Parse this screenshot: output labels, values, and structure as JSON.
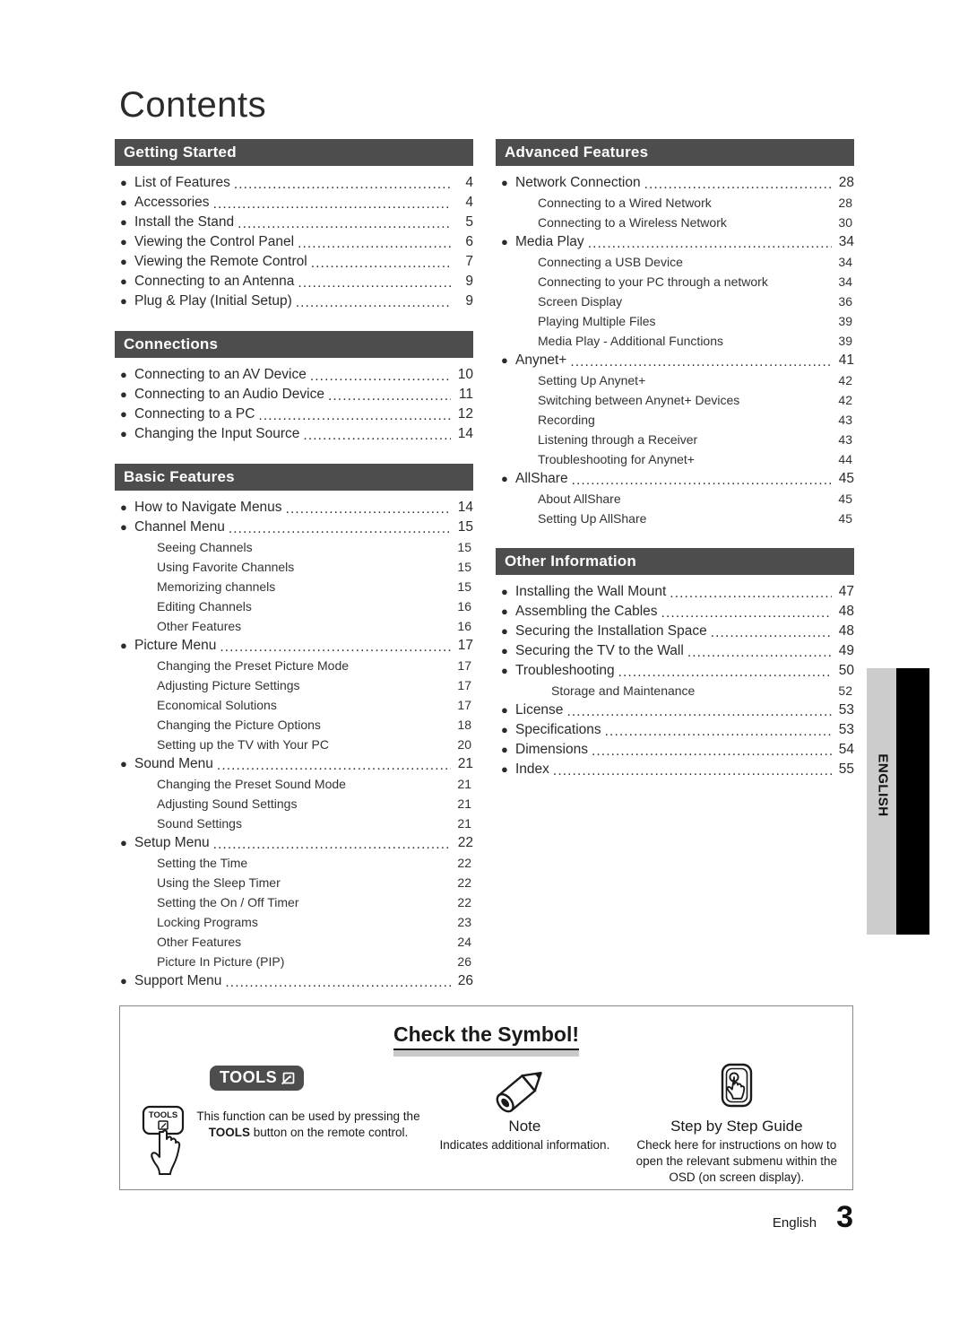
{
  "page": {
    "title": "Contents",
    "footer_language": "English",
    "footer_page_number": "3",
    "side_tab_label": "ENGLISH",
    "accent_bar_color": "#4d4d4d",
    "side_tab_gray": "#cccccc",
    "side_tab_black": "#000000"
  },
  "columns": {
    "left": [
      {
        "heading": "Getting Started",
        "entries": [
          {
            "level": 1,
            "label": "List of Features",
            "page": "4"
          },
          {
            "level": 1,
            "label": "Accessories",
            "page": "4"
          },
          {
            "level": 1,
            "label": "Install the Stand",
            "page": "5"
          },
          {
            "level": 1,
            "label": "Viewing the Control Panel",
            "page": "6"
          },
          {
            "level": 1,
            "label": "Viewing the Remote Control",
            "page": "7"
          },
          {
            "level": 1,
            "label": "Connecting to an Antenna",
            "page": "9"
          },
          {
            "level": 1,
            "label": "Plug & Play (Initial Setup)",
            "page": "9"
          }
        ]
      },
      {
        "heading": "Connections",
        "entries": [
          {
            "level": 1,
            "label": "Connecting to an AV Device",
            "page": "10"
          },
          {
            "level": 1,
            "label": "Connecting to an Audio Device",
            "page": "11"
          },
          {
            "level": 1,
            "label": "Connecting to a PC",
            "page": "12"
          },
          {
            "level": 1,
            "label": "Changing the Input Source",
            "page": "14"
          }
        ]
      },
      {
        "heading": "Basic Features",
        "entries": [
          {
            "level": 1,
            "label": "How to Navigate Menus",
            "page": "14"
          },
          {
            "level": 1,
            "label": "Channel Menu",
            "page": "15"
          },
          {
            "level": 2,
            "label": "Seeing Channels",
            "page": "15"
          },
          {
            "level": 2,
            "label": "Using Favorite Channels",
            "page": "15"
          },
          {
            "level": 2,
            "label": "Memorizing channels",
            "page": "15"
          },
          {
            "level": 2,
            "label": "Editing Channels",
            "page": "16"
          },
          {
            "level": 2,
            "label": "Other Features",
            "page": "16"
          },
          {
            "level": 1,
            "label": "Picture Menu",
            "page": "17"
          },
          {
            "level": 2,
            "label": "Changing the Preset Picture Mode",
            "page": "17"
          },
          {
            "level": 2,
            "label": "Adjusting Picture Settings",
            "page": "17"
          },
          {
            "level": 2,
            "label": "Economical Solutions",
            "page": "17"
          },
          {
            "level": 2,
            "label": "Changing the Picture Options",
            "page": "18"
          },
          {
            "level": 2,
            "label": "Setting up the TV with Your PC",
            "page": "20"
          },
          {
            "level": 1,
            "label": "Sound Menu",
            "page": "21"
          },
          {
            "level": 2,
            "label": "Changing the Preset Sound Mode",
            "page": "21"
          },
          {
            "level": 2,
            "label": "Adjusting Sound Settings",
            "page": "21"
          },
          {
            "level": 2,
            "label": "Sound Settings",
            "page": "21"
          },
          {
            "level": 1,
            "label": "Setup Menu",
            "page": "22"
          },
          {
            "level": 2,
            "label": "Setting the Time",
            "page": "22"
          },
          {
            "level": 2,
            "label": "Using the Sleep Timer",
            "page": "22"
          },
          {
            "level": 2,
            "label": "Setting the On / Off Timer",
            "page": "22"
          },
          {
            "level": 2,
            "label": "Locking Programs",
            "page": "23"
          },
          {
            "level": 2,
            "label": "Other Features",
            "page": "24"
          },
          {
            "level": 2,
            "label": "Picture In Picture (PIP)",
            "page": "26"
          },
          {
            "level": 1,
            "label": "Support Menu",
            "page": "26"
          }
        ]
      }
    ],
    "right": [
      {
        "heading": "Advanced Features",
        "entries": [
          {
            "level": 1,
            "label": "Network Connection",
            "page": "28"
          },
          {
            "level": 2,
            "label": "Connecting to a Wired Network",
            "page": "28"
          },
          {
            "level": 2,
            "label": "Connecting to a Wireless Network",
            "page": "30"
          },
          {
            "level": 1,
            "label": "Media Play",
            "page": "34"
          },
          {
            "level": 2,
            "label": "Connecting a USB Device",
            "page": "34"
          },
          {
            "level": 2,
            "label": "Connecting to your PC through a network",
            "page": "34"
          },
          {
            "level": 2,
            "label": "Screen Display",
            "page": "36"
          },
          {
            "level": 2,
            "label": "Playing Multiple Files",
            "page": "39"
          },
          {
            "level": 2,
            "label": "Media Play - Additional Functions",
            "page": "39"
          },
          {
            "level": 1,
            "label": "Anynet+",
            "page": "41"
          },
          {
            "level": 2,
            "label": "Setting Up Anynet+",
            "page": "42"
          },
          {
            "level": 2,
            "label": "Switching between Anynet+ Devices",
            "page": "42"
          },
          {
            "level": 2,
            "label": "Recording",
            "page": "43"
          },
          {
            "level": 2,
            "label": "Listening through a Receiver",
            "page": "43"
          },
          {
            "level": 2,
            "label": "Troubleshooting for Anynet+",
            "page": "44"
          },
          {
            "level": 1,
            "label": "AllShare",
            "page": "45"
          },
          {
            "level": 2,
            "label": "About AllShare",
            "page": "45"
          },
          {
            "level": 2,
            "label": "Setting Up AllShare",
            "page": "45"
          }
        ]
      },
      {
        "heading": "Other Information",
        "entries": [
          {
            "level": 1,
            "label": "Installing the Wall Mount",
            "page": "47"
          },
          {
            "level": 1,
            "label": "Assembling the Cables",
            "page": "48"
          },
          {
            "level": 1,
            "label": "Securing the Installation Space",
            "page": "48"
          },
          {
            "level": 1,
            "label": "Securing the TV to the Wall",
            "page": "49"
          },
          {
            "level": 1,
            "label": "Troubleshooting",
            "page": "50"
          },
          {
            "level": 3,
            "label": "Storage and Maintenance",
            "page": "52"
          },
          {
            "level": 1,
            "label": "License",
            "page": "53"
          },
          {
            "level": 1,
            "label": "Specifications",
            "page": "53"
          },
          {
            "level": 1,
            "label": "Dimensions",
            "page": "54"
          },
          {
            "level": 1,
            "label": "Index",
            "page": "55"
          }
        ]
      }
    ]
  },
  "symbol_box": {
    "title": "Check the Symbol!",
    "items": [
      {
        "icon": "tools-badge-icon",
        "badge_label": "TOOLS",
        "remote_key_label": "TOOLS",
        "description_part1": "This function can be used by pressing the ",
        "description_bold": "TOOLS",
        "description_part2": " button on the remote control."
      },
      {
        "icon": "pencil-icon",
        "heading": "Note",
        "description": "Indicates additional information."
      },
      {
        "icon": "touch-button-icon",
        "heading": "Step by Step Guide",
        "description": "Check here for instructions on how to open the relevant submenu within the OSD (on screen display)."
      }
    ]
  }
}
